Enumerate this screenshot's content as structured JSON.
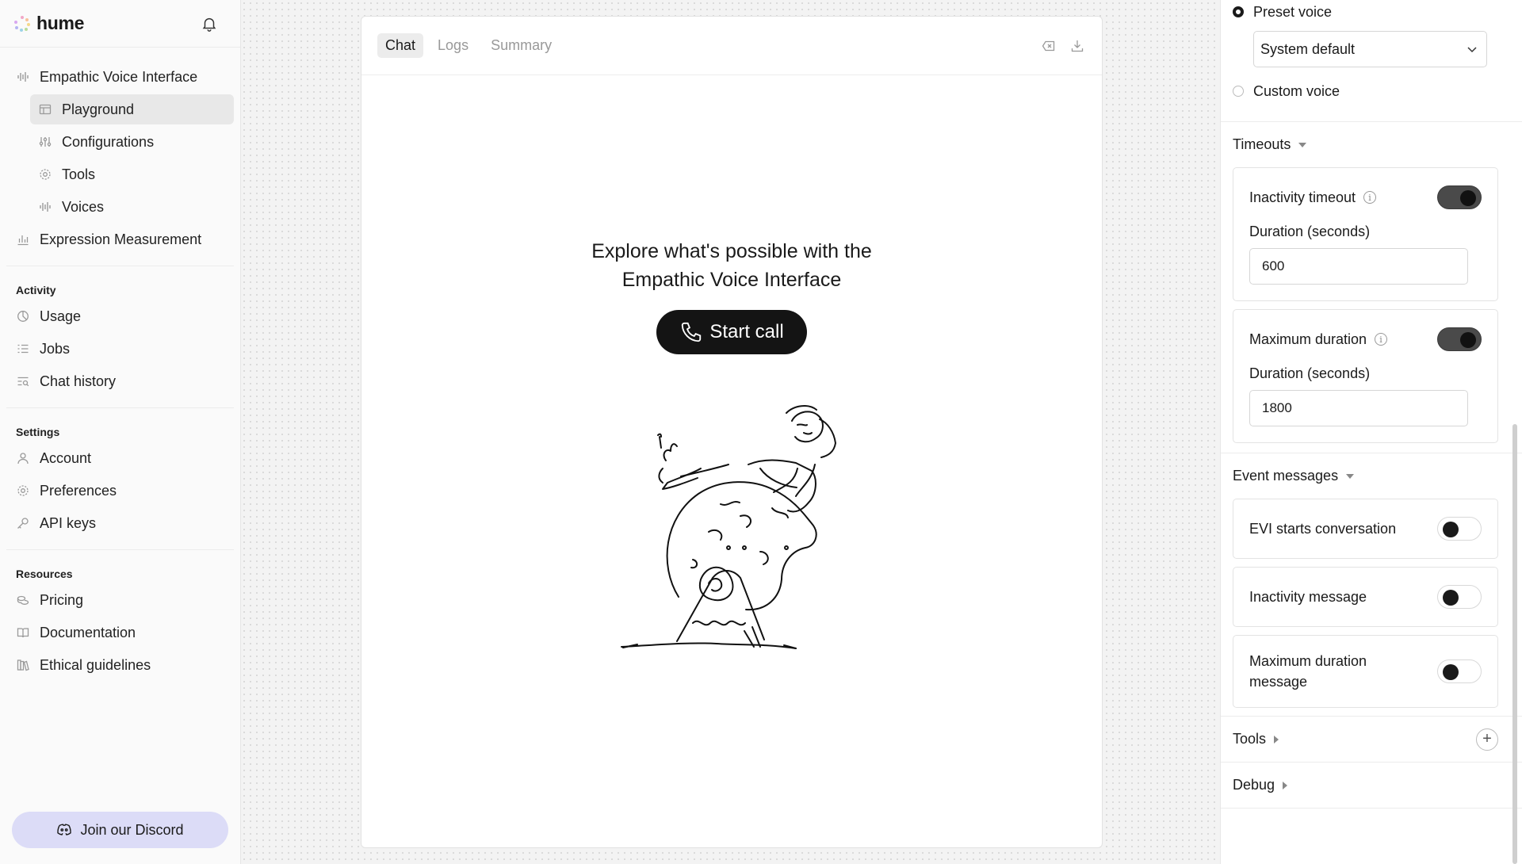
{
  "brand": {
    "name": "hume"
  },
  "sidebar": {
    "primary": [
      {
        "label": "Empathic Voice Interface",
        "icon": "waveform-icon"
      },
      {
        "label": "Playground",
        "icon": "layout-icon",
        "sub": true,
        "active": true
      },
      {
        "label": "Configurations",
        "icon": "sliders-icon",
        "sub": true
      },
      {
        "label": "Tools",
        "icon": "gear-icon",
        "sub": true
      },
      {
        "label": "Voices",
        "icon": "waveform-icon",
        "sub": true
      },
      {
        "label": "Expression Measurement",
        "icon": "bar-chart-icon"
      }
    ],
    "activity": {
      "title": "Activity",
      "items": [
        "Usage",
        "Jobs",
        "Chat history"
      ]
    },
    "settings": {
      "title": "Settings",
      "items": [
        "Account",
        "Preferences",
        "API keys"
      ]
    },
    "resources": {
      "title": "Resources",
      "items": [
        "Pricing",
        "Documentation",
        "Ethical guidelines"
      ]
    },
    "discord_label": "Join our Discord"
  },
  "chat": {
    "tabs": [
      "Chat",
      "Logs",
      "Summary"
    ],
    "active_tab": "Chat",
    "hero_line1": "Explore what's possible with the",
    "hero_line2": "Empathic Voice Interface",
    "start_call": "Start call"
  },
  "panel": {
    "preset_voice": "Preset voice",
    "voice_select": "System default",
    "custom_voice": "Custom voice",
    "timeouts": {
      "title": "Timeouts",
      "inactivity_label": "Inactivity timeout",
      "inactivity_enabled": true,
      "inactivity_duration_label": "Duration (seconds)",
      "inactivity_duration": "600",
      "max_label": "Maximum duration",
      "max_enabled": true,
      "max_duration_label": "Duration (seconds)",
      "max_duration": "1800"
    },
    "events": {
      "title": "Event messages",
      "items": [
        {
          "label": "EVI starts conversation",
          "enabled": false
        },
        {
          "label": "Inactivity message",
          "enabled": false
        },
        {
          "label": "Maximum duration message",
          "enabled": false
        }
      ]
    },
    "tools_title": "Tools",
    "debug_title": "Debug"
  },
  "colors": {
    "accent_discord": "#dcdcf7",
    "button_dark": "#141414",
    "active_nav": "#e8e8e8"
  }
}
